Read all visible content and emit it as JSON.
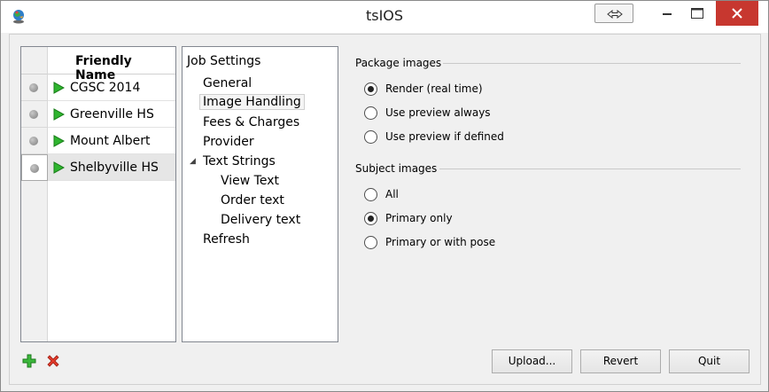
{
  "window": {
    "title": "tsIOS"
  },
  "jobs": {
    "column_header": "Friendly Name",
    "rows": [
      {
        "name": "CGSC 2014"
      },
      {
        "name": "Greenville HS"
      },
      {
        "name": "Mount Albert"
      },
      {
        "name": "Shelbyville HS"
      }
    ],
    "selected_index": 3
  },
  "tree": {
    "root": "Job Settings",
    "items": {
      "general": "General",
      "image_handling": "Image Handling",
      "fees": "Fees & Charges",
      "provider": "Provider",
      "text_strings": "Text Strings",
      "view_text": "View Text",
      "order_text": "Order text",
      "delivery_text": "Delivery text",
      "refresh": "Refresh"
    },
    "selected": "Image Handling"
  },
  "package_images": {
    "title": "Package images",
    "options": [
      {
        "label": "Render (real time)",
        "checked": true
      },
      {
        "label": "Use preview always",
        "checked": false
      },
      {
        "label": "Use preview if defined",
        "checked": false
      }
    ]
  },
  "subject_images": {
    "title": "Subject images",
    "options": [
      {
        "label": "All",
        "checked": false
      },
      {
        "label": "Primary only",
        "checked": true
      },
      {
        "label": "Primary or with pose",
        "checked": false
      }
    ]
  },
  "buttons": {
    "upload": "Upload...",
    "revert": "Revert",
    "quit": "Quit"
  },
  "icons": {
    "app": "globe-icon",
    "resize": "resize-arrows-icon",
    "add": "plus-icon",
    "delete": "x-icon",
    "play": "play-icon"
  }
}
